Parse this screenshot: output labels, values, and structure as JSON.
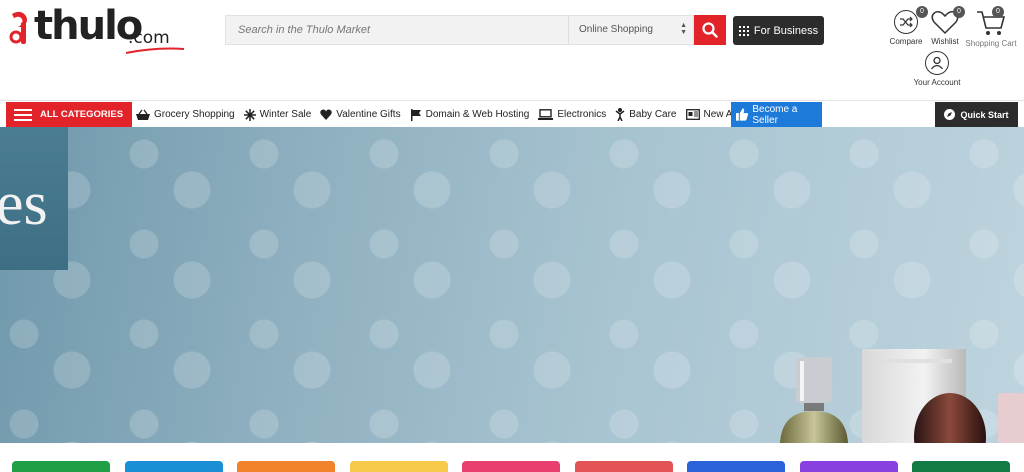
{
  "logo": {
    "word": "thulo",
    "suffix": ".com"
  },
  "search": {
    "placeholder": "Search in the Thulo Market",
    "category": "Online Shopping"
  },
  "business_button": "For Business",
  "header_icons": {
    "compare": {
      "label": "Compare",
      "count": "0"
    },
    "wishlist": {
      "label": "Wishlist",
      "count": "0"
    },
    "cart": {
      "label": "Shopping Cart",
      "count": "0"
    },
    "account": {
      "label": "Your Account"
    }
  },
  "nav": {
    "all_categories": "ALL CATEGORIES",
    "items": [
      {
        "label": "Grocery Shopping",
        "icon": "basket-icon"
      },
      {
        "label": "Winter Sale",
        "icon": "snowflake-icon"
      },
      {
        "label": "Valentine Gifts",
        "icon": "heart-icon"
      },
      {
        "label": "Domain & Web Hosting",
        "icon": "flag-icon"
      },
      {
        "label": "Electronics",
        "icon": "laptop-icon"
      },
      {
        "label": "Baby Care",
        "icon": "baby-icon"
      },
      {
        "label": "New Arrivals",
        "icon": "newspaper-icon"
      }
    ],
    "seller": "Become a Seller",
    "quick_start": "Quick Start"
  },
  "banner": {
    "partial_text": "es"
  },
  "colors": {
    "brand_red": "#e2232a",
    "dark": "#2c2c2c",
    "seller_blue": "#1d7ad9",
    "tiles": [
      "#1fa046",
      "#1a8fd6",
      "#f2832b",
      "#f7c948",
      "#e83f6f",
      "#e35454",
      "#2a62d9",
      "#8a3fe0",
      "#127a45"
    ]
  }
}
